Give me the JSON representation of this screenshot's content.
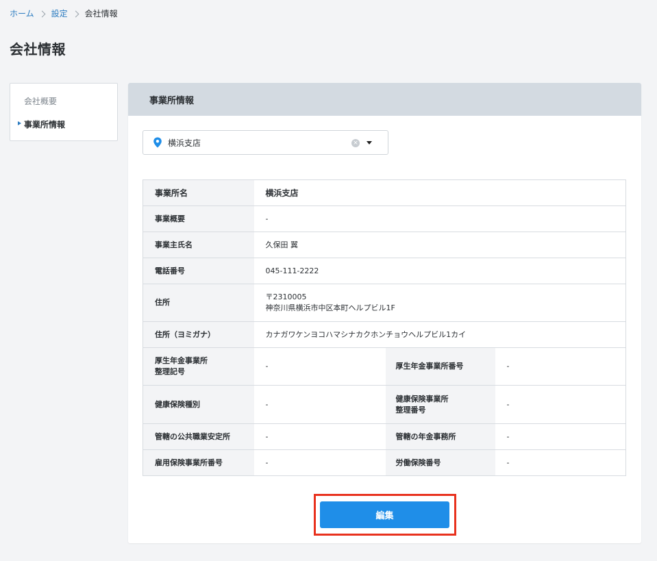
{
  "breadcrumb": {
    "home": "ホーム",
    "settings": "設定",
    "current": "会社情報"
  },
  "page": {
    "title": "会社情報"
  },
  "sidebar": {
    "items": [
      {
        "label": "会社概要",
        "active": false
      },
      {
        "label": "事業所情報",
        "active": true
      }
    ]
  },
  "card": {
    "header": "事業所情報",
    "select": {
      "value": "横浜支店",
      "icons": [
        "location-pin-icon",
        "clear-icon",
        "caret-down-icon"
      ]
    },
    "fields": {
      "office_name_label": "事業所名",
      "office_name_value": "横浜支店",
      "business_summary_label": "事業概要",
      "business_summary_value": "-",
      "owner_name_label": "事業主氏名",
      "owner_name_value": "久保田 翼",
      "phone_label": "電話番号",
      "phone_value": "045-111-2222",
      "address_label": "住所",
      "address_postal": "〒2310005",
      "address_line": "神奈川県横浜市中区本町ヘルプビル1F",
      "address_kana_label": "住所（ヨミガナ）",
      "address_kana_value": "カナガワケンヨコハマシナカクホンチョウヘルプビル1カイ",
      "pension_ref_label_1": "厚生年金事業所",
      "pension_ref_label_2": "整理記号",
      "pension_ref_value": "-",
      "pension_office_no_label": "厚生年金事業所番号",
      "pension_office_no_value": "-",
      "health_type_label": "健康保険種別",
      "health_type_value": "-",
      "health_ref_label_1": "健康保険事業所",
      "health_ref_label_2": "整理番号",
      "health_ref_value": "-",
      "job_office_label": "管轄の公共職業安定所",
      "job_office_value": "-",
      "pension_jurisdiction_label": "管轄の年金事務所",
      "pension_jurisdiction_value": "-",
      "employment_ins_label": "雇用保険事業所番号",
      "employment_ins_value": "-",
      "labor_ins_label": "労働保険番号",
      "labor_ins_value": "-"
    },
    "edit_button": "編集"
  },
  "colors": {
    "accent": "#1f8ee8",
    "link": "#2b7bc0",
    "highlight": "#e8311d",
    "header_bg": "#d3dae1"
  }
}
